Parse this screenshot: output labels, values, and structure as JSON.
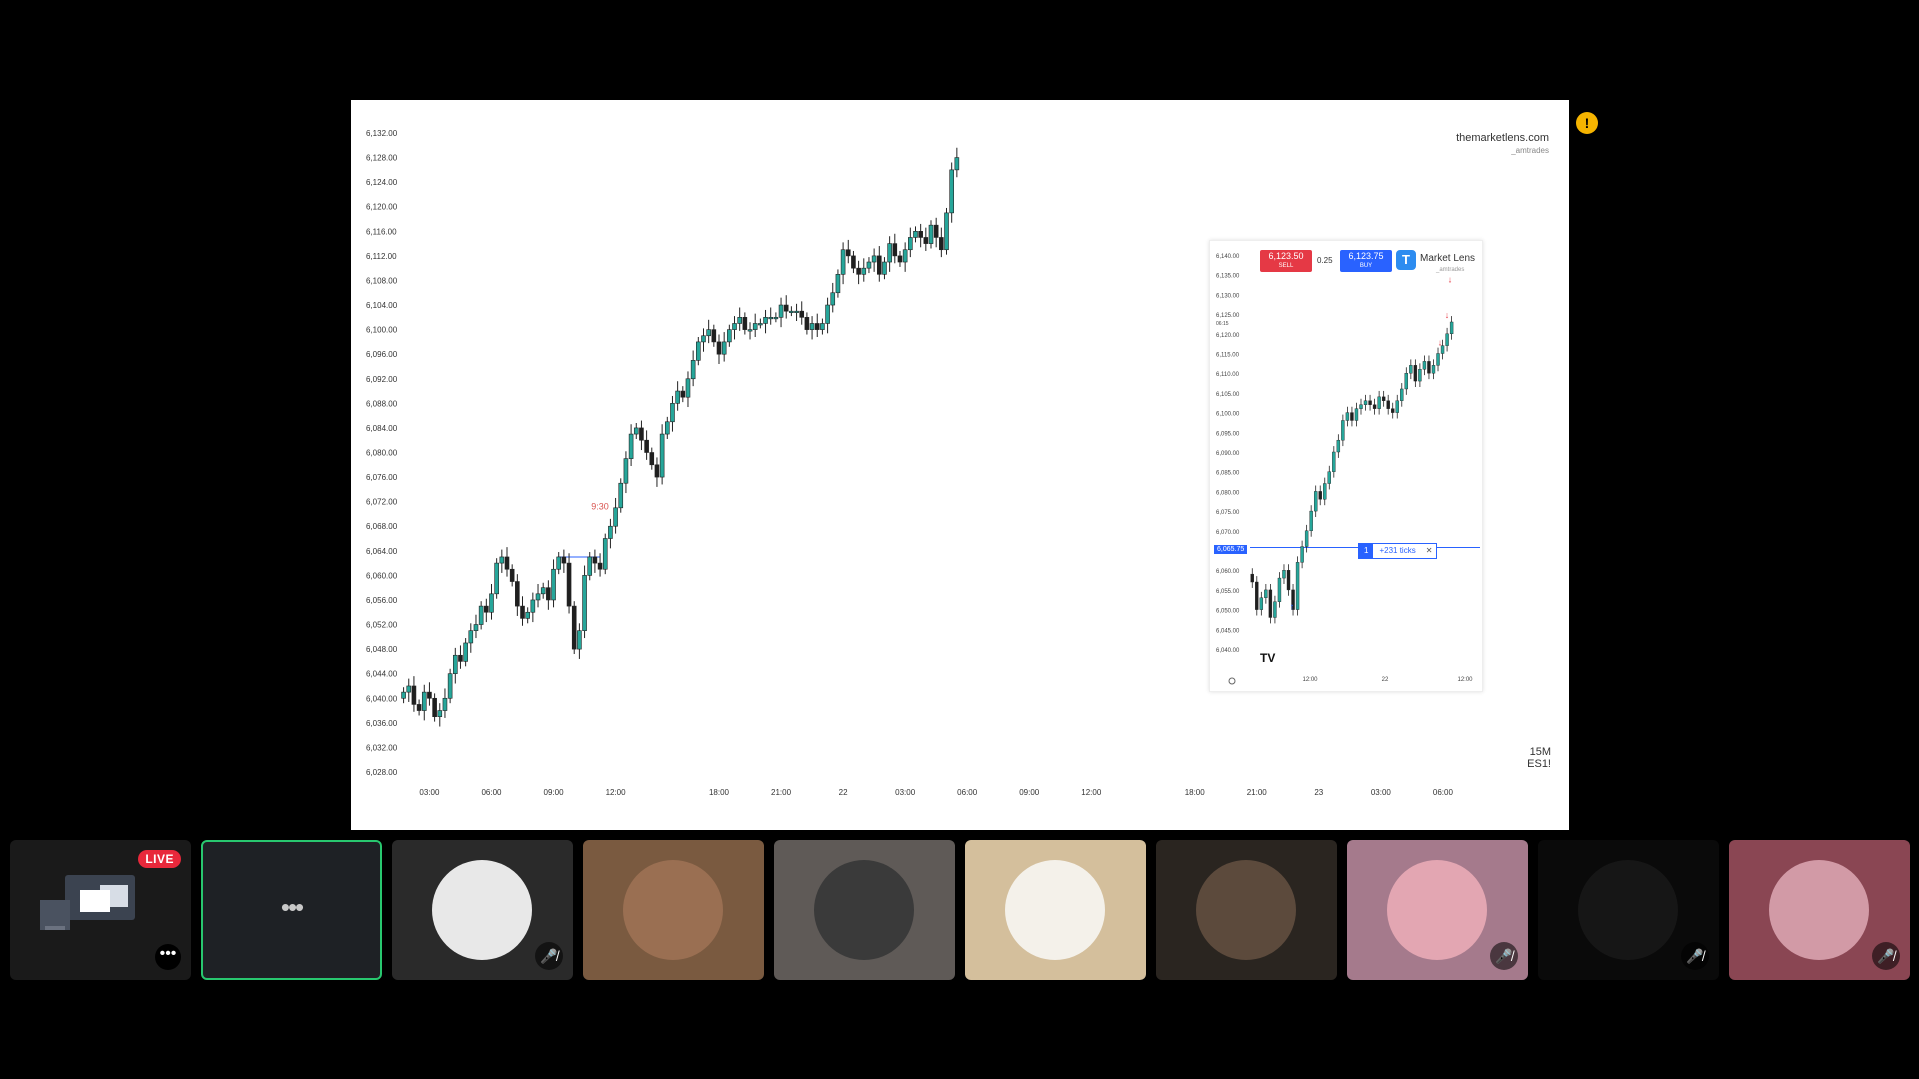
{
  "chart_data": {
    "type": "candlestick",
    "main": {
      "y_ticks": [
        "6,132.00",
        "6,128.00",
        "6,124.00",
        "6,120.00",
        "6,116.00",
        "6,112.00",
        "6,108.00",
        "6,104.00",
        "6,100.00",
        "6,096.00",
        "6,092.00",
        "6,088.00",
        "6,084.00",
        "6,080.00",
        "6,076.00",
        "6,072.00",
        "6,068.00",
        "6,064.00",
        "6,060.00",
        "6,056.00",
        "6,052.00",
        "6,048.00",
        "6,044.00",
        "6,040.00",
        "6,036.00",
        "6,032.00",
        "6,028.00"
      ],
      "ylim": [
        6028,
        6132
      ],
      "x_ticks": [
        {
          "label": "03:00",
          "i": 5
        },
        {
          "label": "06:00",
          "i": 17
        },
        {
          "label": "09:00",
          "i": 29
        },
        {
          "label": "12:00",
          "i": 41
        },
        {
          "label": "18:00",
          "i": 61
        },
        {
          "label": "21:00",
          "i": 73
        },
        {
          "label": "22",
          "i": 85
        },
        {
          "label": "03:00",
          "i": 97
        },
        {
          "label": "06:00",
          "i": 109
        },
        {
          "label": "09:00",
          "i": 121
        },
        {
          "label": "12:00",
          "i": 133
        },
        {
          "label": "18:00",
          "i": 153
        },
        {
          "label": "21:00",
          "i": 165
        },
        {
          "label": "23",
          "i": 177
        },
        {
          "label": "03:00",
          "i": 189
        },
        {
          "label": "06:00",
          "i": 201
        }
      ],
      "slot_count": 205,
      "annotation": {
        "label": "9:30",
        "i": 38
      },
      "closes": [
        6041,
        6042,
        6039,
        6038,
        6041,
        6040,
        6037,
        6038,
        6040,
        6044,
        6047,
        6046,
        6049,
        6051,
        6052,
        6055,
        6054,
        6057,
        6062,
        6063,
        6061,
        6059,
        6055,
        6053,
        6054,
        6056,
        6057,
        6058,
        6056,
        6061,
        6063,
        6062,
        6055,
        6048,
        6051,
        6060,
        6063,
        6062,
        6061,
        6066,
        6068,
        6071,
        6075,
        6079,
        6083,
        6084,
        6082,
        6080,
        6078,
        6076,
        6083,
        6085,
        6088,
        6090,
        6089,
        6092,
        6095,
        6098,
        6099,
        6100,
        6098,
        6096,
        6098,
        6100,
        6101,
        6102,
        6100,
        6100,
        6101,
        6101,
        6102,
        6102,
        6102,
        6104,
        6103,
        6103,
        6103,
        6102,
        6100,
        6101,
        6100,
        6101,
        6104,
        6106,
        6109,
        6113,
        6112,
        6110,
        6109,
        6110,
        6111,
        6112,
        6109,
        6111,
        6114,
        6112,
        6111,
        6113,
        6115,
        6116,
        6115,
        6114,
        6117,
        6115,
        6113,
        6119,
        6126,
        6128
      ],
      "price_line": 6063
    },
    "inset": {
      "y_ticks": [
        "6,140.00",
        "6,135.00",
        "6,130.00",
        "6,125.00",
        "6,120.00",
        "6,115.00",
        "6,110.00",
        "6,105.00",
        "6,100.00",
        "6,095.00",
        "6,090.00",
        "6,085.00",
        "6,080.00",
        "6,075.00",
        "6,070.00",
        "6,065.75",
        "6,060.00",
        "6,055.00",
        "6,050.00",
        "6,045.00",
        "6,040.00"
      ],
      "x_ticks": [
        "12:00",
        "22",
        "12:00"
      ],
      "sell_price": "6,123.50",
      "sell_label": "SELL",
      "buy_price": "6,123.75",
      "buy_label": "BUY",
      "spread": "0.25",
      "brand": "Market Lens",
      "brand_sub": "_amtrades",
      "current_price": "6,065.75",
      "position_qty": "1",
      "position_ticks": "+231 ticks",
      "close_symbol": "✕",
      "countdown": "06:15",
      "logo": "TV",
      "closes": [
        6057,
        6050,
        6053,
        6055,
        6048,
        6052,
        6058,
        6060,
        6055,
        6050,
        6062,
        6066,
        6070,
        6075,
        6080,
        6078,
        6082,
        6085,
        6090,
        6093,
        6098,
        6100,
        6098,
        6101,
        6102,
        6103,
        6102,
        6101,
        6104,
        6103,
        6101,
        6100,
        6103,
        6106,
        6110,
        6112,
        6108,
        6111,
        6113,
        6110,
        6112,
        6115,
        6117,
        6120,
        6123
      ]
    }
  },
  "watermark": {
    "brand": "themarketlens.com",
    "sub": "_amtrades"
  },
  "timeframe": {
    "interval": "15M",
    "symbol": "ES1!"
  },
  "alert_icon": "exclamation-icon",
  "participants": [
    {
      "id": "host",
      "badge": "LIVE",
      "more": "•••",
      "bg": "#1a1a1a"
    },
    {
      "id": "more",
      "label": "•••",
      "bg": "#1e2125"
    },
    {
      "id": "p1",
      "bg": "#2a2a2a",
      "avatar": "#e8e8e8",
      "muted": true
    },
    {
      "id": "p2",
      "bg": "#7a5a40",
      "avatar": "#9a6f52",
      "muted": false
    },
    {
      "id": "p3",
      "bg": "#5f5a57",
      "avatar": "#3a3a3a",
      "muted": false
    },
    {
      "id": "p4",
      "bg": "#d4bf9c",
      "avatar": "#f4f1ea",
      "muted": false
    },
    {
      "id": "p5",
      "bg": "#2a2520",
      "avatar": "#5c4a3c",
      "muted": false
    },
    {
      "id": "p6",
      "bg": "#a57a8c",
      "avatar": "#e3a6b2",
      "muted": true
    },
    {
      "id": "p7",
      "bg": "#0a0a0a",
      "avatar": "#161616",
      "muted": true
    },
    {
      "id": "p8",
      "bg": "#8a4653",
      "avatar": "#d29aa6",
      "muted": true
    }
  ],
  "mute_symbol": "🎤̸",
  "colors": {
    "up": "#26a69a",
    "down": "#1f1f1f",
    "accent": "#2962ff",
    "live": "#e8283b",
    "speaker": "#28c76f",
    "alert": "#f6b400"
  }
}
